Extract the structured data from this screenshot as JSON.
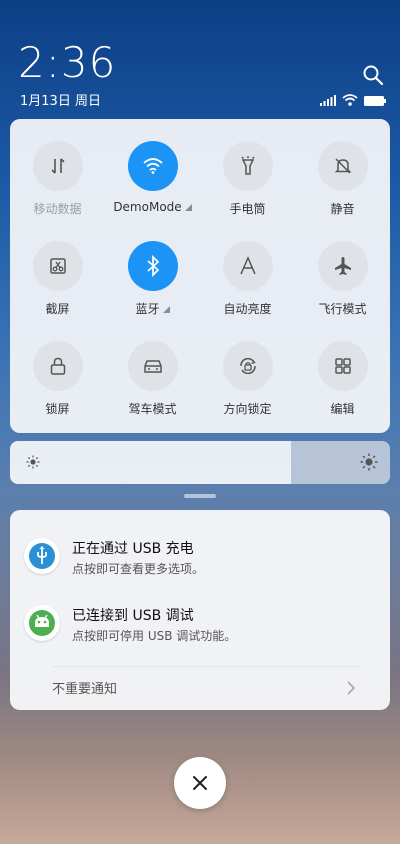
{
  "header": {
    "time": "2:36",
    "date": "1月13日 周日"
  },
  "icons": {
    "search": "search-icon",
    "signal": "cellular-signal-icon",
    "wifi": "wifi-icon",
    "battery": "battery-icon"
  },
  "toggles": [
    {
      "label": "移动数据",
      "icon": "mobile-data-icon",
      "active": false
    },
    {
      "label": "DemoMode",
      "icon": "wifi-icon",
      "active": true
    },
    {
      "label": "手电筒",
      "icon": "flashlight-icon",
      "active": false
    },
    {
      "label": "静音",
      "icon": "mute-icon",
      "active": false
    },
    {
      "label": "截屏",
      "icon": "screenshot-icon",
      "active": false
    },
    {
      "label": "蓝牙",
      "icon": "bluetooth-icon",
      "active": true
    },
    {
      "label": "自动亮度",
      "icon": "auto-brightness-icon",
      "active": false
    },
    {
      "label": "飞行模式",
      "icon": "airplane-icon",
      "active": false
    },
    {
      "label": "锁屏",
      "icon": "lock-icon",
      "active": false
    },
    {
      "label": "驾车模式",
      "icon": "car-icon",
      "active": false
    },
    {
      "label": "方向锁定",
      "icon": "rotation-lock-icon",
      "active": false
    },
    {
      "label": "编辑",
      "icon": "grid-icon",
      "active": false
    }
  ],
  "brightness": {
    "level": 0.74
  },
  "notifications": [
    {
      "title": "正在通过 USB 充电",
      "subtitle": "点按即可查看更多选项。",
      "icon": "usb-icon"
    },
    {
      "title": "已连接到 USB 调试",
      "subtitle": "点按即可停用 USB 调试功能。",
      "icon": "android-icon"
    }
  ],
  "unimportant_label": "不重要通知",
  "colors": {
    "accent": "#1b94f5",
    "tile_off": "#dfe3e8"
  }
}
